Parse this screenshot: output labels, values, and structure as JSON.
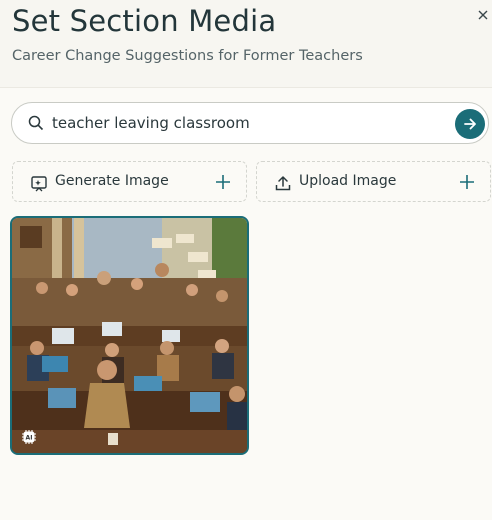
{
  "header": {
    "title": "Set Section Media",
    "subtitle": "Career Change Suggestions for Former Teachers",
    "close_icon": "close-icon"
  },
  "search": {
    "value": "teacher leaving classroom",
    "icon": "search-icon",
    "submit_icon": "arrow-right-icon"
  },
  "actions": {
    "generate_label": "Generate Image",
    "generate_icon": "ai-image-icon",
    "upload_label": "Upload Image",
    "upload_icon": "upload-icon",
    "add_icon": "plus-icon"
  },
  "result": {
    "selected": true,
    "badge_icon": "ai-chip-icon"
  },
  "colors": {
    "accent": "#1b6d78",
    "background": "#fbfaf6",
    "header_bg": "#f7f6f1",
    "text": "#23363a"
  }
}
